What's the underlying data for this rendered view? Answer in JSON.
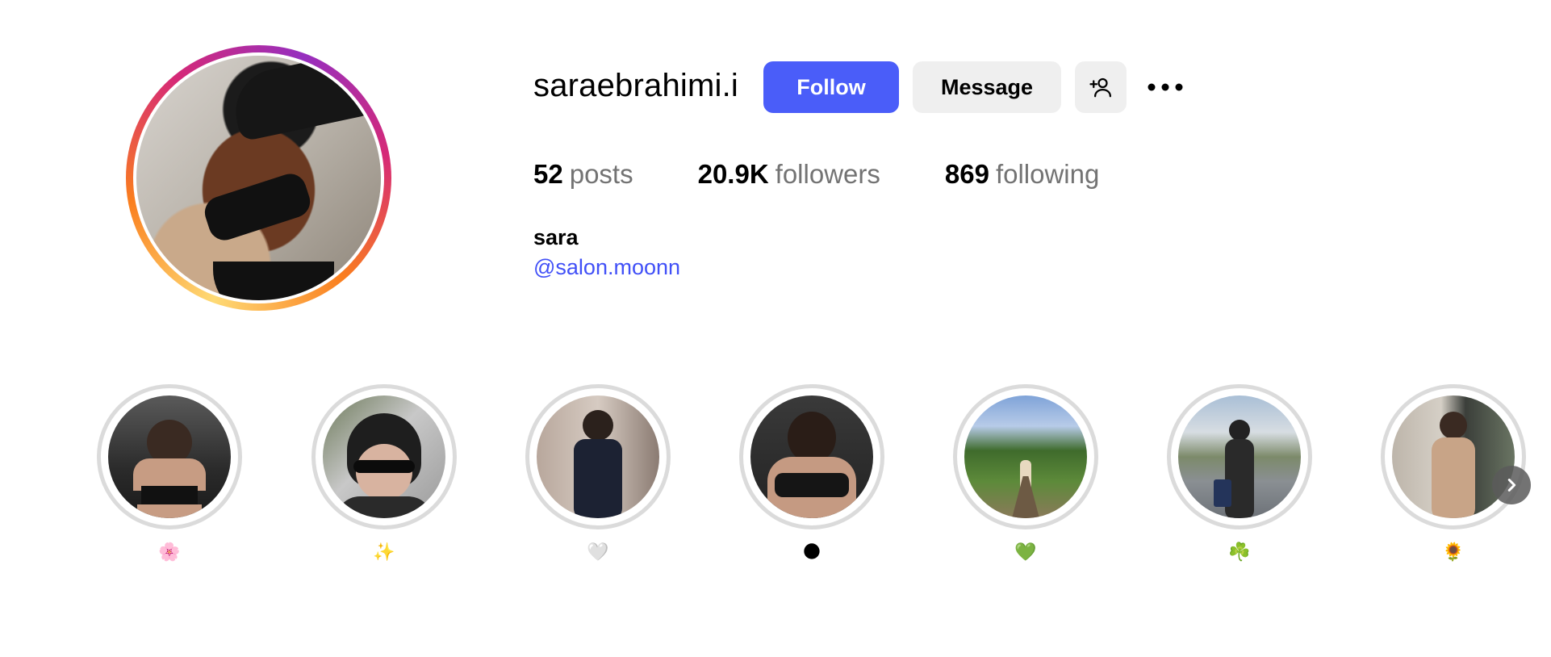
{
  "profile": {
    "username": "saraebrahimi.i",
    "follow_label": "Follow",
    "message_label": "Message",
    "add_user_icon": "person-add-icon",
    "more_icon": "more-horizontal-icon",
    "stats": {
      "posts_count": "52",
      "posts_label": "posts",
      "followers_count": "20.9K",
      "followers_label": "followers",
      "following_count": "869",
      "following_label": "following"
    },
    "full_name": "sara",
    "bio_link": "@salon.moonn"
  },
  "highlights": [
    {
      "label": "🌸"
    },
    {
      "label": "✨"
    },
    {
      "label": "🤍"
    },
    {
      "label": "🌑"
    },
    {
      "label": "💚"
    },
    {
      "label": "☘️"
    },
    {
      "label": "🌻"
    }
  ],
  "colors": {
    "follow_button": "#4a5df9",
    "secondary_button": "#efefef",
    "link": "#4150f7",
    "muted_text": "#737373",
    "highlight_ring": "#dbdbdb"
  },
  "next_icon": "chevron-right-icon"
}
